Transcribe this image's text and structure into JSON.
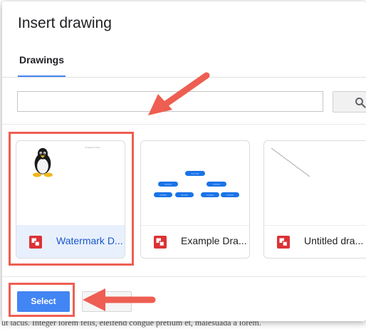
{
  "dialog": {
    "title": "Insert drawing",
    "tabs": [
      {
        "label": "Drawings",
        "active": true
      }
    ],
    "search": {
      "value": "",
      "placeholder": ""
    },
    "drawings": [
      {
        "name": "Watermark D...",
        "selected": true,
        "thumb_caption": "Company name"
      },
      {
        "name": "Example Dra...",
        "selected": false,
        "chart_labels": {
          "root": "Parent Node",
          "level1": [
            "Child Node",
            "Child Node"
          ],
          "level2": [
            "Child Node",
            "Child Node",
            "Child Node",
            "Child Node"
          ]
        }
      },
      {
        "name": "Untitled dra...",
        "selected": false
      }
    ],
    "buttons": {
      "select": "Select",
      "cancel": ""
    }
  },
  "background": {
    "text": "ut lacus. Integer lorem felis, eleifend congue pretium et, malesuada a lorem."
  },
  "colors": {
    "accent": "#4285f4",
    "annotation": "#ee5e52",
    "selected_bg": "#e8f0fe",
    "drive_red": "#db3236"
  },
  "annotations": [
    "arrow-to-drawings",
    "arrow-to-select-button"
  ]
}
